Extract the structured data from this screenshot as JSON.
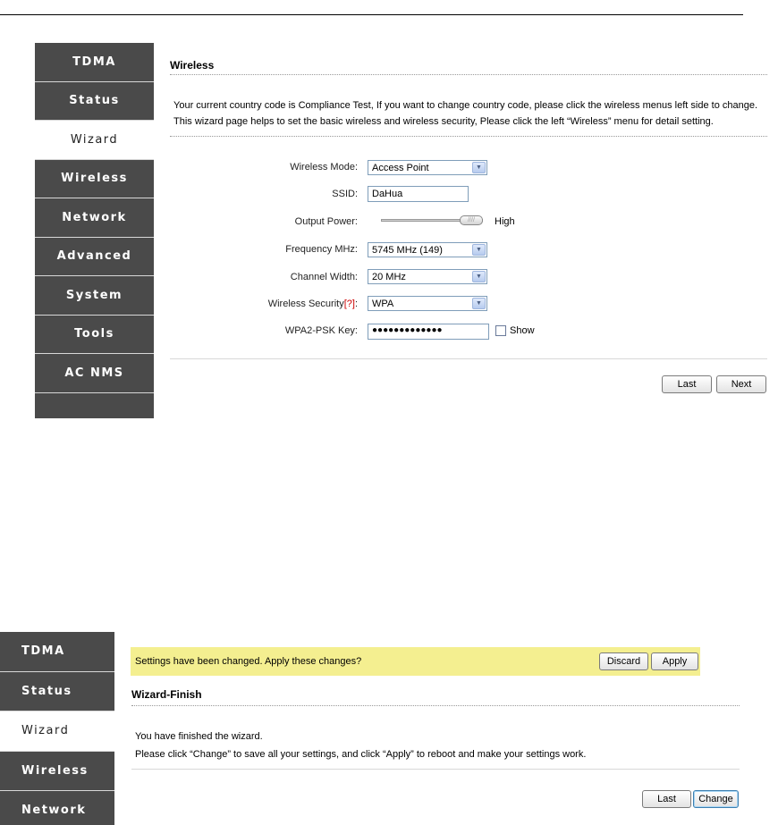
{
  "menu1": {
    "items": [
      {
        "label": "TDMA",
        "active": false
      },
      {
        "label": "Status",
        "active": false
      },
      {
        "label": "Wizard",
        "active": true
      },
      {
        "label": "Wireless",
        "active": false
      },
      {
        "label": "Network",
        "active": false
      },
      {
        "label": "Advanced",
        "active": false
      },
      {
        "label": "System",
        "active": false
      },
      {
        "label": "Tools",
        "active": false
      },
      {
        "label": "AC NMS",
        "active": false
      }
    ]
  },
  "wizard": {
    "title": "Wireless",
    "info_line1": "Your current country code is Compliance Test, If you want to change country code, please click the wireless menus left side to change.",
    "info_line2": "This wizard page helps to set the basic wireless and wireless security, Please click the left “Wireless” menu for detail setting.",
    "fields": {
      "wireless_mode": {
        "label": "Wireless Mode:",
        "value": "Access Point"
      },
      "ssid": {
        "label": "SSID:",
        "value": "DaHua"
      },
      "output_power": {
        "label": "Output Power:",
        "value_text": "High",
        "level_percent": 100
      },
      "frequency": {
        "label": "Frequency MHz:",
        "value": "5745 MHz (149)"
      },
      "channel_width": {
        "label": "Channel Width:",
        "value": "20 MHz"
      },
      "wireless_security": {
        "label": "Wireless Security",
        "help": "[?]",
        "colon": ":",
        "value": "WPA"
      },
      "psk_key": {
        "label": "WPA2-PSK Key:",
        "value": "●●●●●●●●●●●●●",
        "show_label": "Show"
      }
    },
    "buttons": {
      "last": "Last",
      "next": "Next"
    }
  },
  "menu2": {
    "items": [
      {
        "label": "TDMA",
        "active": false
      },
      {
        "label": "Status",
        "active": false
      },
      {
        "label": "Wizard",
        "active": true
      },
      {
        "label": "Wireless",
        "active": false
      },
      {
        "label": "Network",
        "active": false
      }
    ]
  },
  "finish": {
    "notice_text": "Settings have been changed. Apply these changes?",
    "discard_label": "Discard",
    "apply_label": "Apply",
    "title": "Wizard-Finish",
    "line1": "You have finished the wizard.",
    "line2": "Please click “Change” to save all your settings, and click “Apply” to reboot and make your settings work.",
    "buttons": {
      "last": "Last",
      "change": "Change"
    }
  },
  "colors": {
    "menu_bg": "#4a4a4a",
    "notice_bg": "#f4ef90",
    "help_link": "#cc0000"
  }
}
